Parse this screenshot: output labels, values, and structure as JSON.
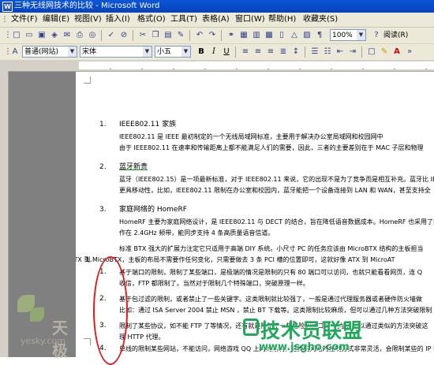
{
  "window": {
    "title": "三种无线网技术的比较 - Microsoft Word",
    "app_icon": "word-icon"
  },
  "menu": [
    "文件(F)",
    "编辑(E)",
    "视图(V)",
    "插入(I)",
    "格式(O)",
    "工具(T)",
    "表格(A)",
    "窗口(W)",
    "帮助(H)",
    "收藏夹(S)"
  ],
  "toolbar": {
    "zoom": "100%",
    "help_label": "阅读(R)"
  },
  "format": {
    "style": "普通(网站)",
    "font": "宋体",
    "size": "小五"
  },
  "doc": {
    "items": [
      {
        "num": "1.",
        "title": "IEEE802.11 家族",
        "l1": "IEEE802.11 是 IEEE 最初制定的一个无线局域网标准，主要用于解决办公室局域网和校园网中",
        "l2": "由于 IEEE802.11 在速率和传输距离上都不能满足人们的需要，因此，三者的主要差别在于 MAC 子层和物理"
      },
      {
        "num": "2.",
        "title": "蓝牙新贵",
        "l1": "蓝牙（IEEE802.15）是一项最新标准，对于 IEEE802.11 来说，它的出现不是为了竞争而是相互补充。蓝牙比 IE",
        "l2": "更具移动性，比如，IEEE802.11 限制在办公室和校园内，蓝牙能把一个设备连接到 LAN 和 WAN，甚至支持全"
      },
      {
        "num": "3.",
        "title": "家庭网络的 HomeRF",
        "l1": "HomeRF 主要为家庭网络设计，是 IEEE802.11 与 DECT 的结合，旨在降低语音数据成本。HomeRF 也采用了扩频",
        "l2": "作在 2.4GHz 频带，能同步支持 4 条高质量语音信道。"
      }
    ],
    "para1": "标准 BTX 强大的扩展力注定它只适用于高端 DIY 系统。小尺寸 PC 的任务应该由 MicroBTX 结构的主板担当",
    "para2": "BTX 到 MicroBTX，主板的布局不需要作任何变化，只需要做去 3 条 PCI 槽的位置即可，这就好像 ATX 到 MicroAT",
    "list": [
      {
        "num": "1.",
        "l1": "基于端口的限制，限制了某些端口，是极端的情况是限制的只有 80 端口可以访问，也就只能看看网页，连 Q",
        "l2": "收信，FTP 都限制了。当然对于限制几个特殊端口，突破原理一样。"
      },
      {
        "num": "2.",
        "l1": "基于包过滤的限制，或者禁止了一些关键字。这类限制就比较强了，一般是通过代理服务器或者硬件防火墙做",
        "l2": "比如：通过 ISA Server 2004 禁止 MSN ，禁止 BT 下载等。这类限制比较麻烦，但可以通过几种方法突破限制"
      },
      {
        "num": "3.",
        "l1": "限制了某些协议，如不能 FTP 了等情况，还有就是限制了一些危险的端口 IP 地址，可以通过类似的方法突破这",
        "l2": "理 HTTP 代理。"
      },
      {
        "num": "4.",
        "l1": "单线的限制某些网站，不能访问，网络游戏 QQ 上网的限制，这类的网站的控制方式非常灵活，会限制某些的 IP 地址。",
        "l2": ""
      }
    ],
    "partial_num": "1."
  },
  "watermarks": {
    "tianji": "天极",
    "yesky": "yesky.com",
    "jsgho_cn": "技术员联盟",
    "jsgho_url": "www.jsgho.com"
  }
}
